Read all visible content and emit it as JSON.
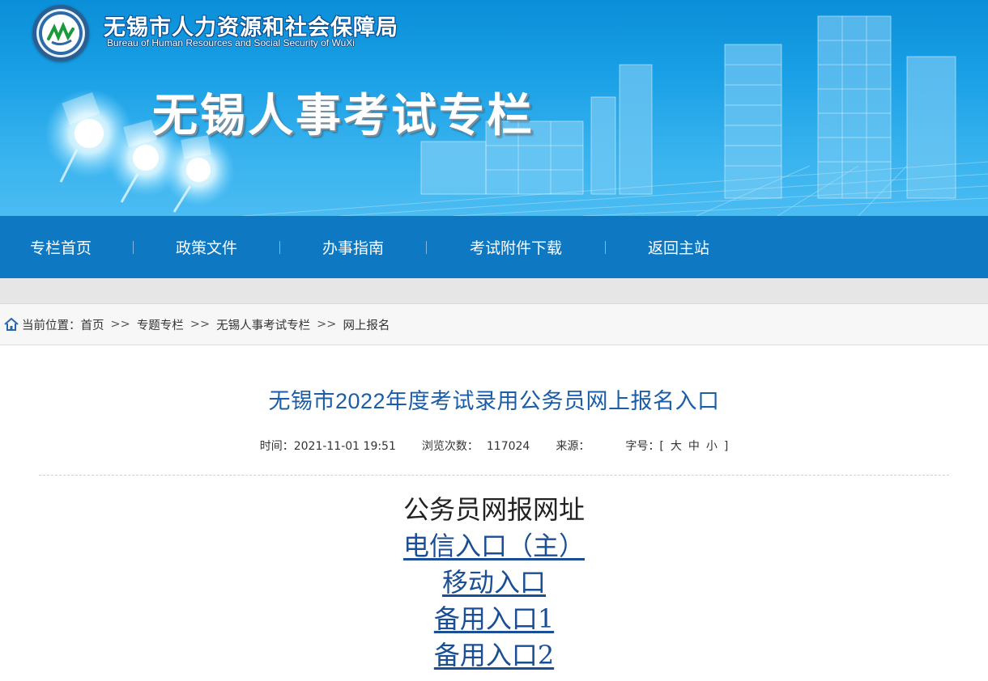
{
  "header": {
    "org_name_cn": "无锡市人力资源和社会保障局",
    "org_name_en": "Bureau of Human Resources and Social Security of WuXi",
    "banner_title": "无锡人事考试专栏"
  },
  "nav": {
    "items": [
      {
        "label": "专栏首页"
      },
      {
        "label": "政策文件"
      },
      {
        "label": "办事指南"
      },
      {
        "label": "考试附件下载"
      },
      {
        "label": "返回主站"
      }
    ]
  },
  "breadcrumb": {
    "prefix": "当前位置：",
    "items": [
      "首页",
      "专题专栏",
      "无锡人事考试专栏",
      "网上报名"
    ],
    "separator": ">>"
  },
  "article": {
    "title": "无锡市2022年度考试录用公务员网上报名入口",
    "meta": {
      "time_label": "时间：",
      "time_value": "2021-11-01 19:51",
      "views_label": "浏览次数：",
      "views_value": "117024",
      "source_label": "来源：",
      "source_value": "",
      "font_label": "字号：",
      "bracket_open": "[",
      "bracket_close": "]",
      "size_large": "大",
      "size_medium": "中",
      "size_small": "小"
    },
    "content": {
      "heading": "公务员网报网址",
      "links": [
        {
          "label": "电信入口（主）"
        },
        {
          "label": "移动入口"
        },
        {
          "label": "备用入口1"
        },
        {
          "label": "备用入口2"
        }
      ]
    }
  },
  "colors": {
    "nav_bg": "#0f78c2",
    "title_blue": "#1b5da6",
    "link_blue": "#1a4f95"
  }
}
